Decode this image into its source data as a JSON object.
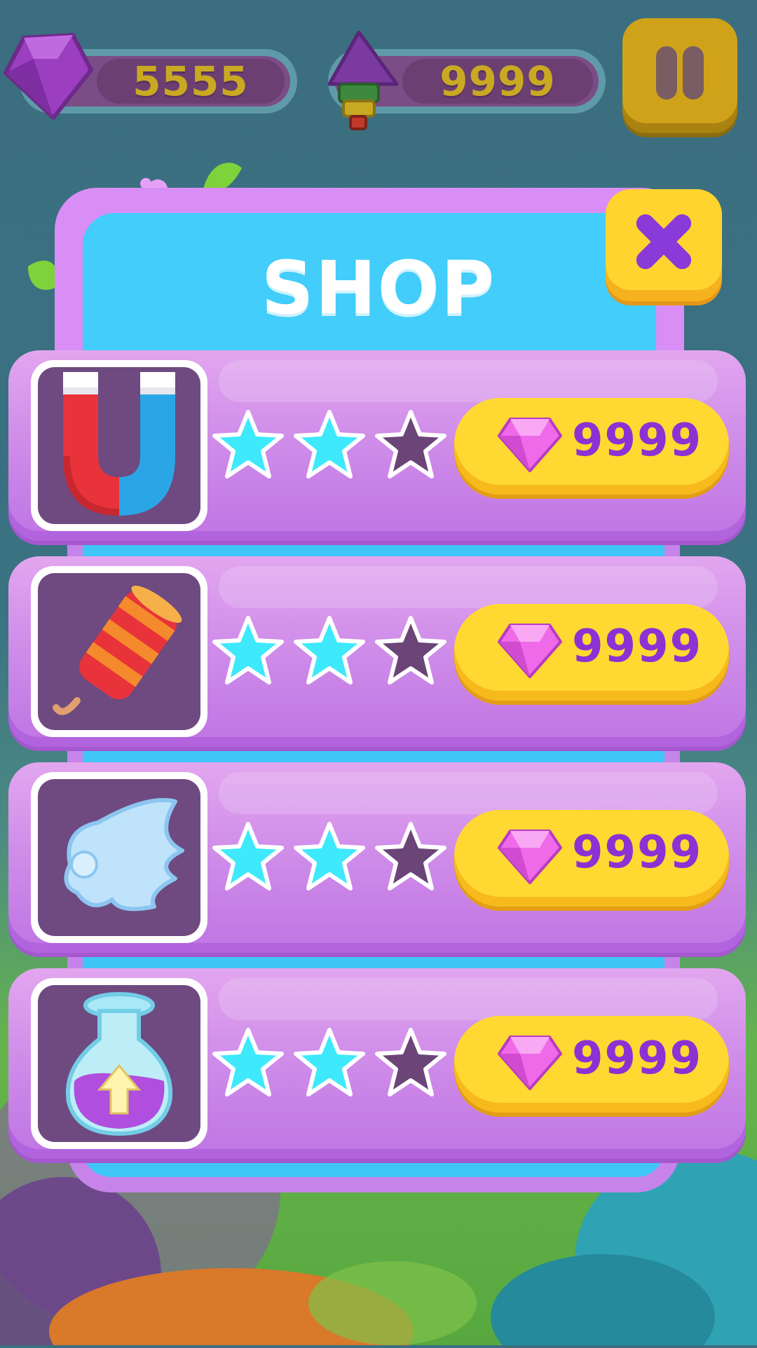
{
  "hud": {
    "gems_value": "5555",
    "rockets_value": "9999"
  },
  "shop": {
    "title": "SHOP"
  },
  "items": [
    {
      "icon": "magnet-icon",
      "stars_filled": 2,
      "stars_total": 3,
      "price": "9999"
    },
    {
      "icon": "firework-icon",
      "stars_filled": 2,
      "stars_total": 3,
      "price": "9999"
    },
    {
      "icon": "wing-icon",
      "stars_filled": 2,
      "stars_total": 3,
      "price": "9999"
    },
    {
      "icon": "potion-icon",
      "stars_filled": 2,
      "stars_total": 3,
      "price": "9999"
    }
  ],
  "colors": {
    "star_filled": "#3ee9fb",
    "star_empty": "#6b4478",
    "price_text": "#8a32d4",
    "button_yellow": "#ffd931"
  }
}
